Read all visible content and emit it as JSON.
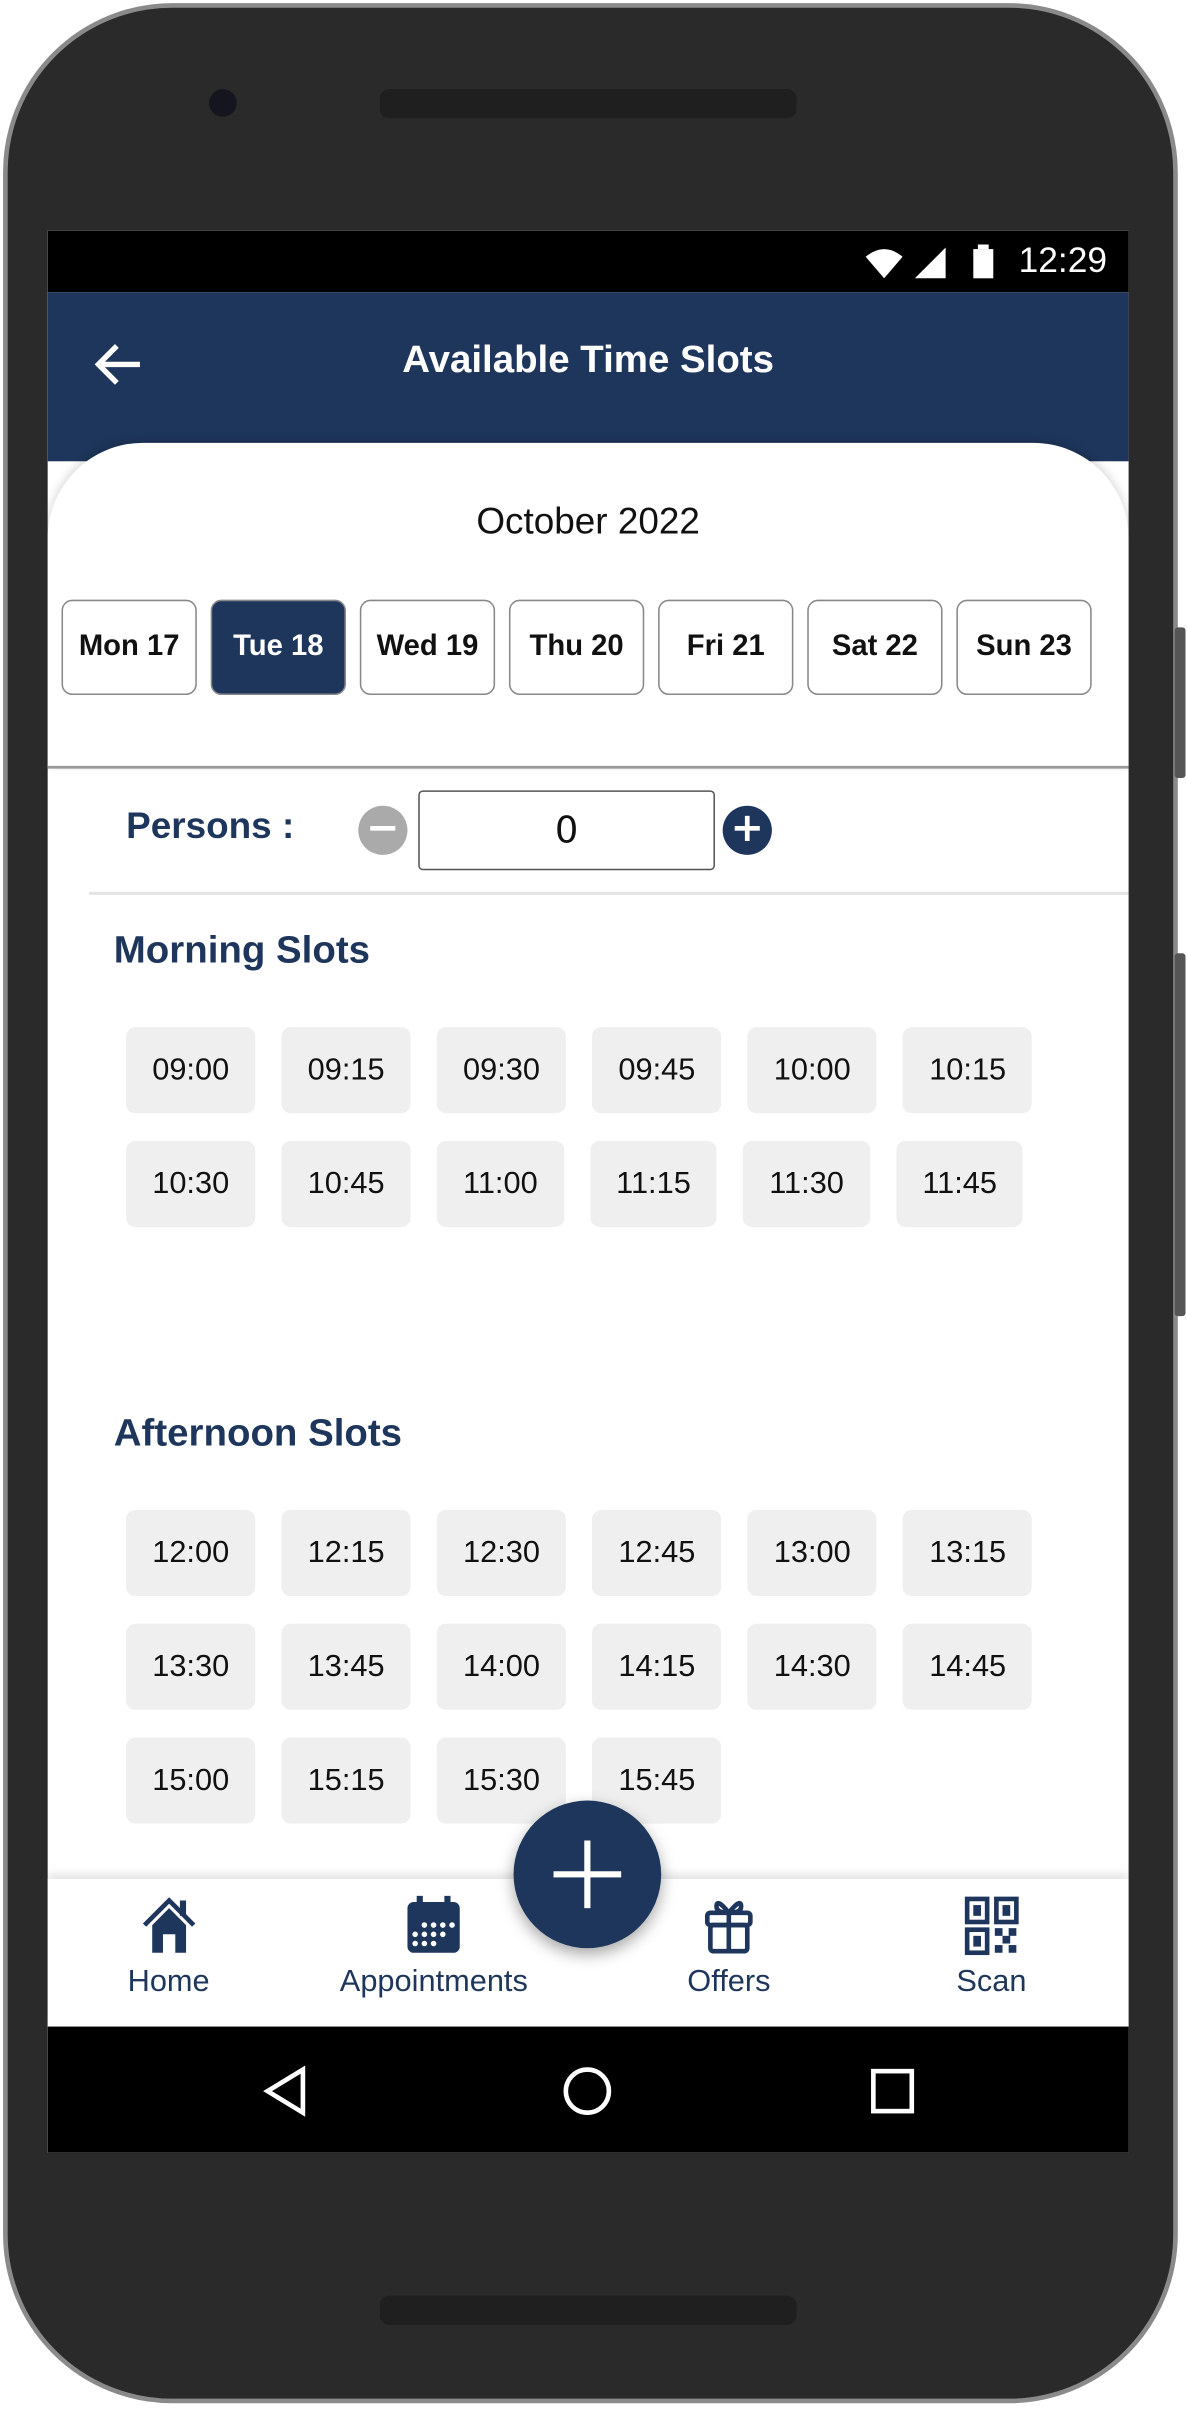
{
  "status_bar": {
    "time": "12:29",
    "icons": [
      "wifi-icon",
      "signal-icon",
      "battery-icon"
    ]
  },
  "app_bar": {
    "title": "Available Time Slots",
    "back_icon": "arrow-left-icon"
  },
  "calendar": {
    "month": "October 2022",
    "days": [
      {
        "label": "Mon 17",
        "selected": false
      },
      {
        "label": "Tue 18",
        "selected": true
      },
      {
        "label": "Wed 19",
        "selected": false
      },
      {
        "label": "Thu 20",
        "selected": false
      },
      {
        "label": "Fri 21",
        "selected": false
      },
      {
        "label": "Sat 22",
        "selected": false
      },
      {
        "label": "Sun 23",
        "selected": false
      }
    ]
  },
  "persons": {
    "label": "Persons :",
    "value": "0",
    "minus": "−",
    "plus": "+"
  },
  "morning": {
    "title": "Morning Slots",
    "slots": [
      "09:00",
      "09:15",
      "09:30",
      "09:45",
      "10:00",
      "10:15",
      "10:30",
      "10:45",
      "11:00",
      "11:15",
      "11:30",
      "11:45"
    ]
  },
  "afternoon": {
    "title": "Afternoon Slots",
    "slots": [
      "12:00",
      "12:15",
      "12:30",
      "12:45",
      "13:00",
      "13:15",
      "13:30",
      "13:45",
      "14:00",
      "14:15",
      "14:30",
      "14:45",
      "15:00",
      "15:15",
      "15:30",
      "15:45"
    ]
  },
  "bottom_nav": [
    {
      "label": "Home",
      "icon": "home-icon"
    },
    {
      "label": "Appointments",
      "icon": "calendar-icon"
    },
    {
      "label": "Offers",
      "icon": "gift-icon"
    },
    {
      "label": "Scan",
      "icon": "qr-code-icon"
    }
  ],
  "fab": {
    "icon": "plus-icon"
  },
  "colors": {
    "primary": "#1e365c",
    "chip_bg": "#efefef",
    "minus_disabled": "#aaaaaa"
  }
}
